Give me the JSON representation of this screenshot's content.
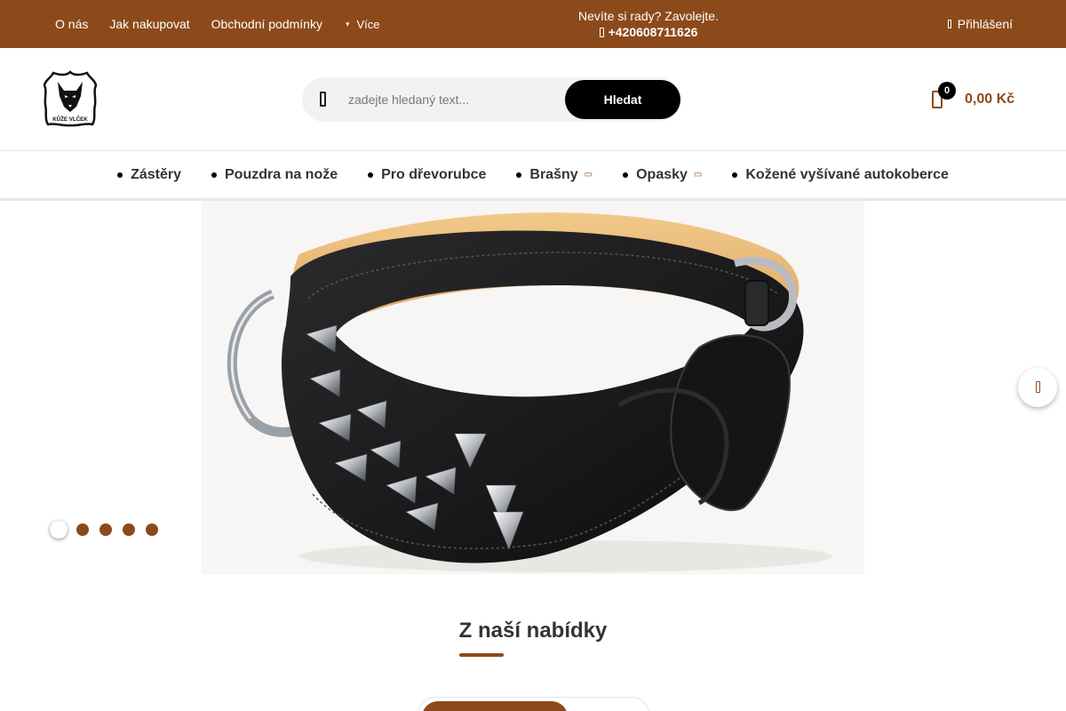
{
  "topbar": {
    "links": [
      "O nás",
      "Jak nakupovat",
      "Obchodní podmínky"
    ],
    "more_label": "Více",
    "help_text": "Nevíte si rady? Zavolejte.",
    "phone": "+420608711626",
    "login_label": "Přihlášení"
  },
  "header": {
    "logo_text": "KŮŽE VLČEK",
    "search_placeholder": "zadejte hledaný text...",
    "search_button": "Hledat",
    "cart_count": "0",
    "cart_total": "0,00 Kč"
  },
  "nav": {
    "items": [
      {
        "label": "Zástěry",
        "has_submenu": false
      },
      {
        "label": "Pouzdra na nože",
        "has_submenu": false
      },
      {
        "label": "Pro dřevorubce",
        "has_submenu": false
      },
      {
        "label": "Brašny",
        "has_submenu": true
      },
      {
        "label": "Opasky",
        "has_submenu": true
      },
      {
        "label": "Kožené vyšívané autokoberce",
        "has_submenu": false
      }
    ]
  },
  "slider": {
    "slide_subject": "black leather dog collar with metal spikes",
    "slide_count": 5,
    "active_slide": 1
  },
  "section": {
    "title": "Z naší nabídky"
  },
  "colors": {
    "brand": "#8c4a1b",
    "button": "#000000"
  }
}
